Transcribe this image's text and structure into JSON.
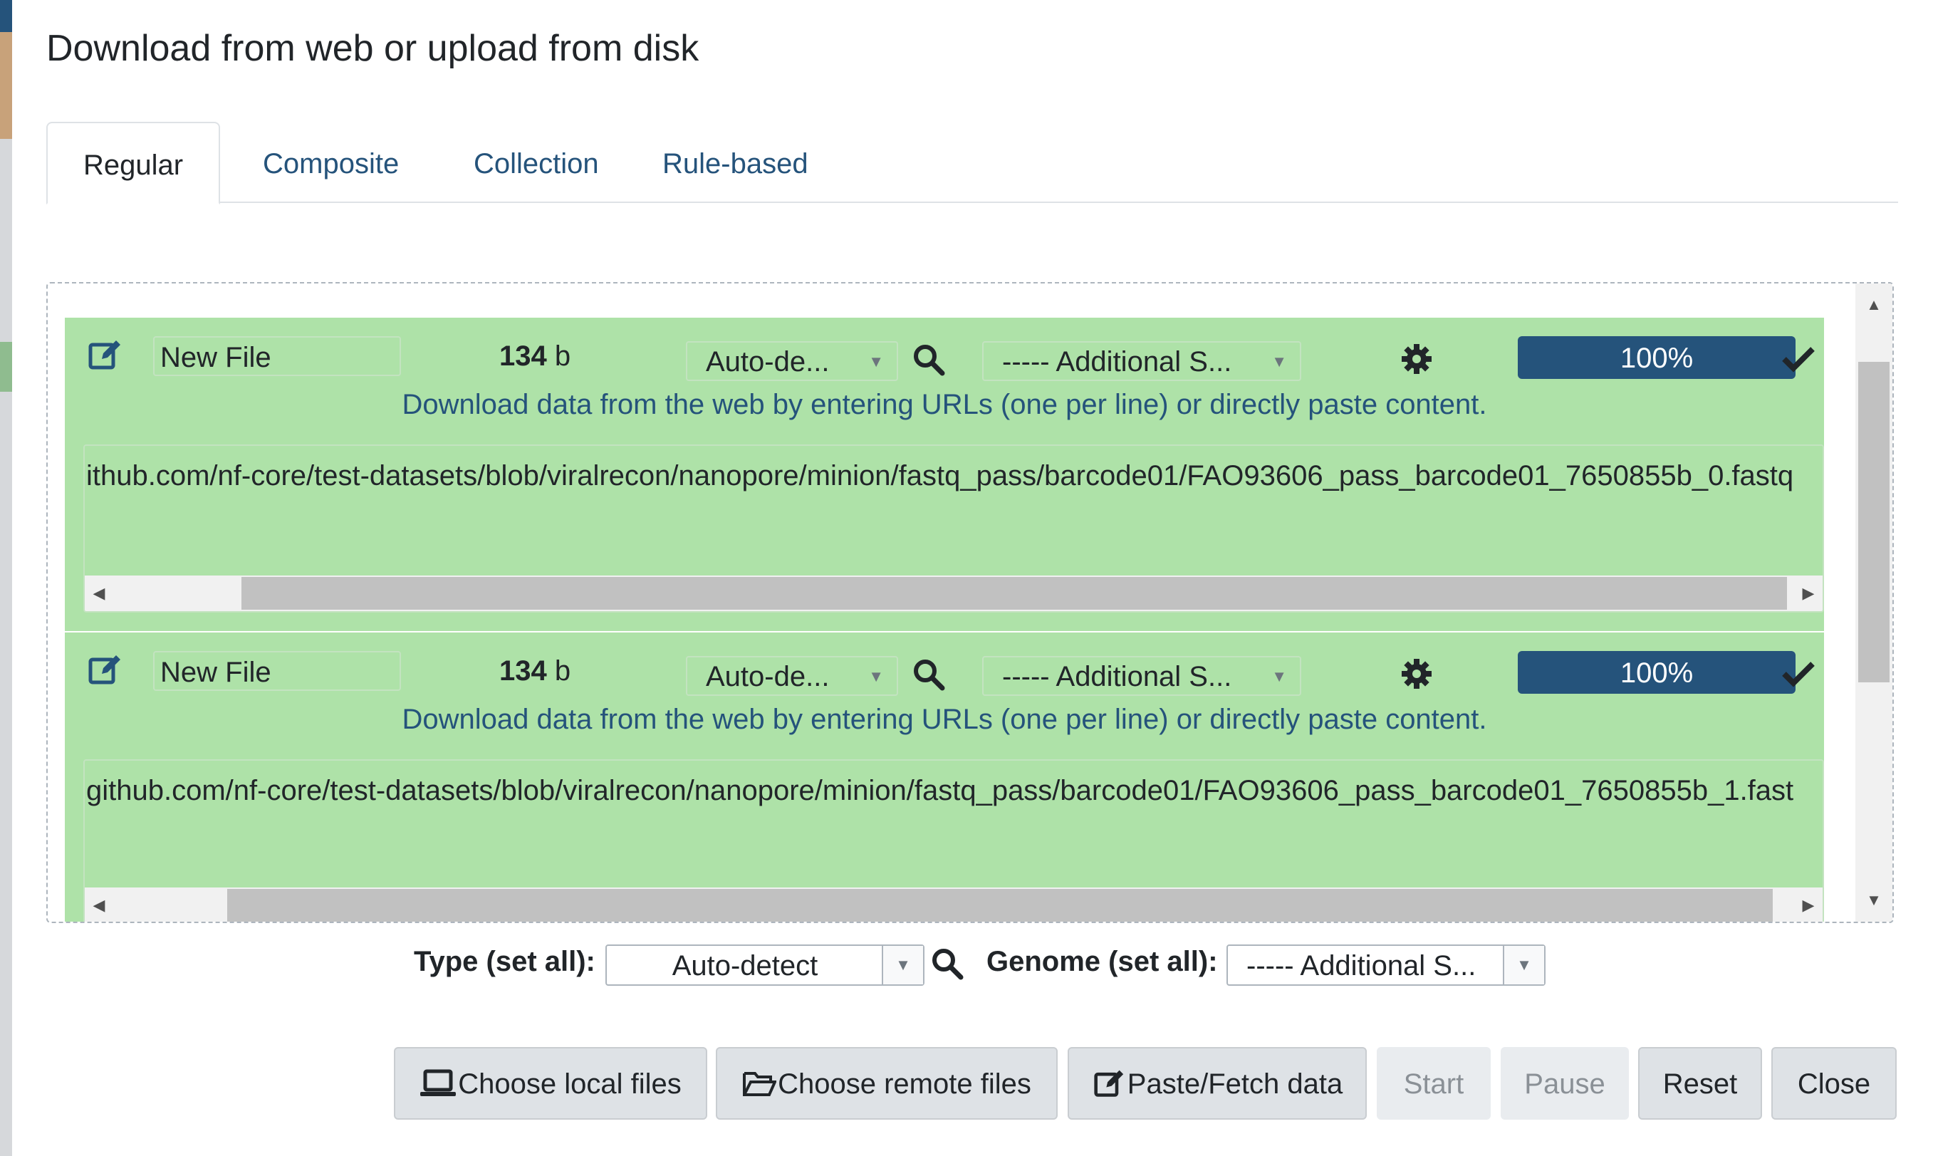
{
  "dialog": {
    "title": "Download from web or upload from disk"
  },
  "tabs": [
    {
      "label": "Regular",
      "active": true
    },
    {
      "label": "Composite",
      "active": false
    },
    {
      "label": "Collection",
      "active": false
    },
    {
      "label": "Rule-based",
      "active": false
    }
  ],
  "uploads": [
    {
      "name": "New File",
      "size_value": "134",
      "size_unit": "b",
      "type": "Auto-de...",
      "genome": "----- Additional S...",
      "progress": "100%",
      "progress_percent": 100,
      "hint": "Download data from the web by entering URLs (one per line) or directly paste content.",
      "url": "ithub.com/nf-core/test-datasets/blob/viralrecon/nanopore/minion/fastq_pass/barcode01/FAO93606_pass_barcode01_7650855b_0.fastq"
    },
    {
      "name": "New File",
      "size_value": "134",
      "size_unit": "b",
      "type": "Auto-de...",
      "genome": "----- Additional S...",
      "progress": "100%",
      "progress_percent": 100,
      "hint": "Download data from the web by entering URLs (one per line) or directly paste content.",
      "url": "github.com/nf-core/test-datasets/blob/viralrecon/nanopore/minion/fastq_pass/barcode01/FAO93606_pass_barcode01_7650855b_1.fast"
    }
  ],
  "set_all": {
    "type_label": "Type (set all):",
    "type_value": "Auto-detect",
    "genome_label": "Genome (set all):",
    "genome_value": "----- Additional S..."
  },
  "buttons": {
    "choose_local": "Choose local files",
    "choose_remote": "Choose remote files",
    "paste_fetch": "Paste/Fetch data",
    "start": "Start",
    "pause": "Pause",
    "reset": "Reset",
    "close": "Close"
  },
  "colors": {
    "brand": "#25537b",
    "row_success": "#aee2a8"
  }
}
